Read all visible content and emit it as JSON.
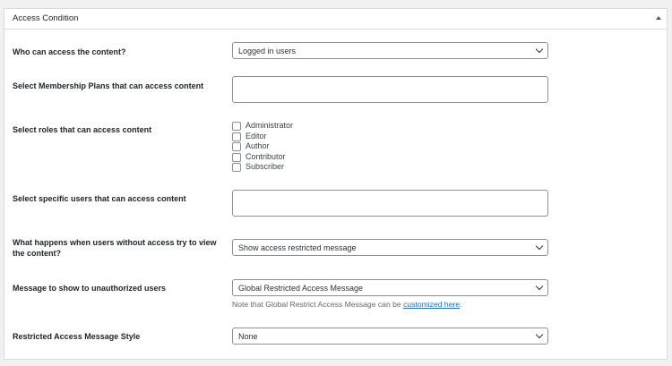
{
  "panel": {
    "title": "Access Condition"
  },
  "fields": {
    "who_can_access": {
      "label": "Who can access the content?",
      "value": "Logged in users"
    },
    "membership_plans": {
      "label": "Select Membership Plans that can access content",
      "value": ""
    },
    "roles": {
      "label": "Select roles that can access content",
      "options": [
        {
          "label": "Administrator",
          "checked": false
        },
        {
          "label": "Editor",
          "checked": false
        },
        {
          "label": "Author",
          "checked": false
        },
        {
          "label": "Contributor",
          "checked": false
        },
        {
          "label": "Subscriber",
          "checked": false
        }
      ]
    },
    "specific_users": {
      "label": "Select specific users that can access content",
      "value": ""
    },
    "no_access_behavior": {
      "label": "What happens when users without access try to view the content?",
      "value": "Show access restricted message"
    },
    "unauthorized_message": {
      "label": "Message to show to unauthorized users",
      "value": "Global Restricted Access Message",
      "note_prefix": "Note that Global Restrict Access Message can be ",
      "note_link": "customized here",
      "note_suffix": "."
    },
    "message_style": {
      "label": "Restricted Access Message Style",
      "value": "None"
    }
  },
  "colors": {
    "link": "#2271b1",
    "border": "#8c8f94",
    "background": "#f1f1f1"
  }
}
